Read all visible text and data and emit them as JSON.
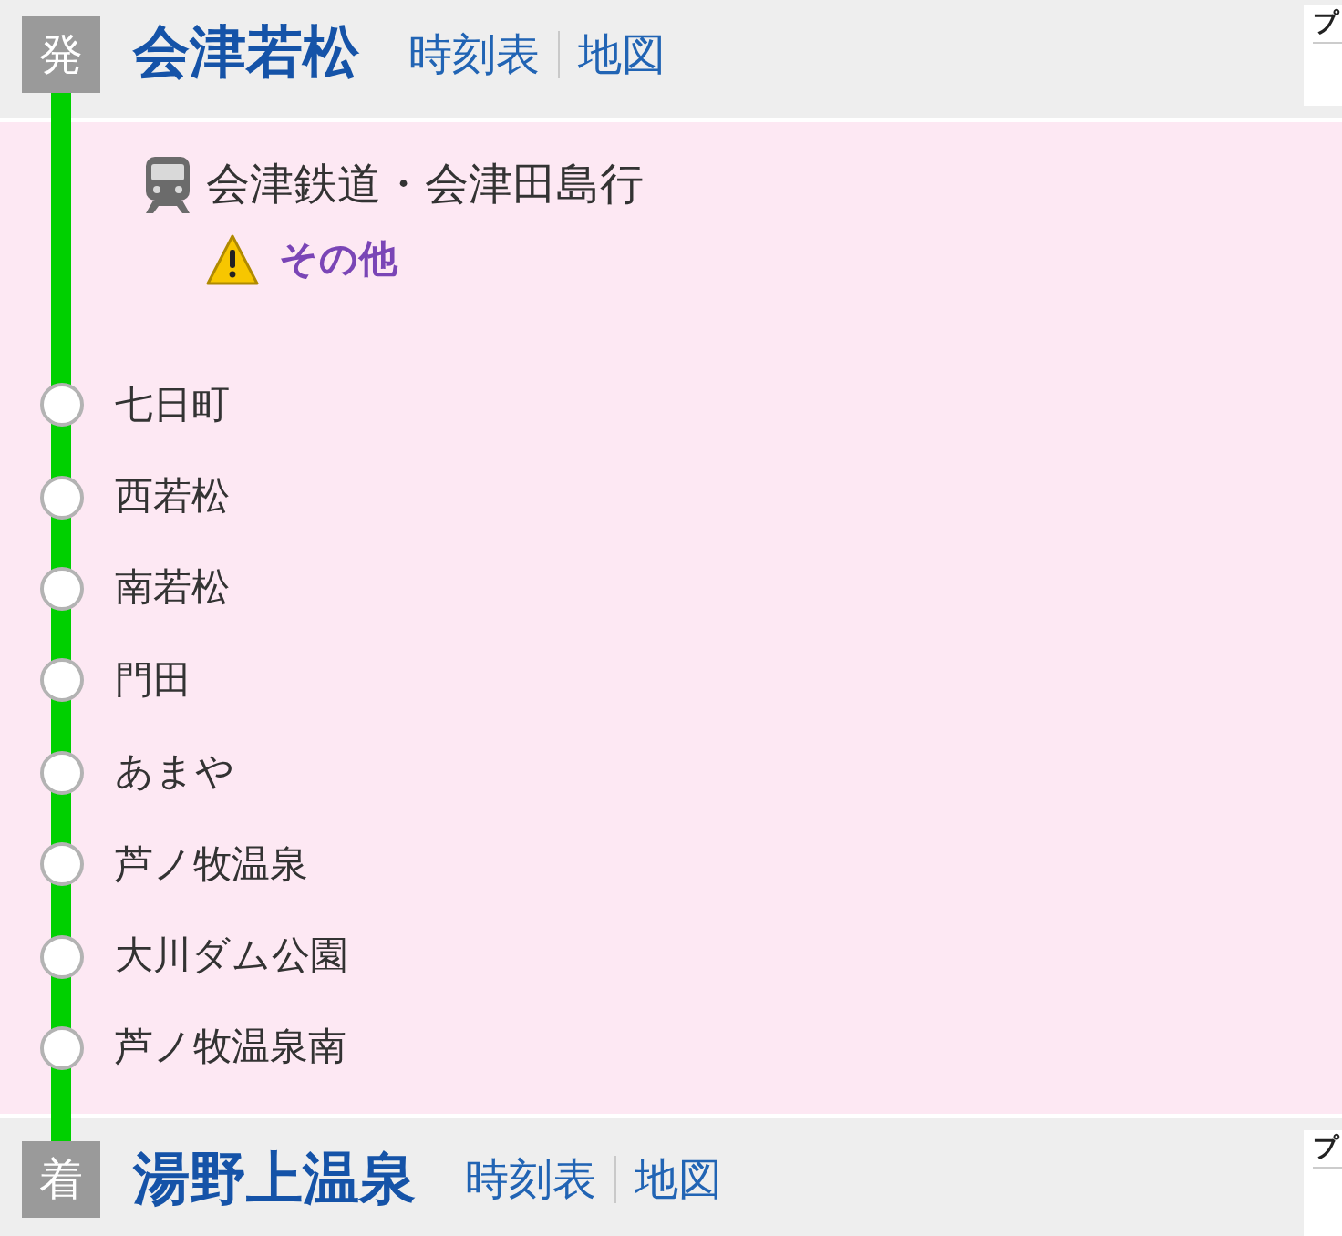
{
  "departure": {
    "badge": "発",
    "station": "会津若松",
    "links": [
      "時刻表",
      "地図"
    ],
    "side_card": {
      "title": "プ"
    }
  },
  "segment": {
    "line": "会津鉄道・会津田島行",
    "notice": "その他",
    "stops": [
      {
        "name": "七日町"
      },
      {
        "name": "西若松"
      },
      {
        "name": "南若松"
      },
      {
        "name": "門田"
      },
      {
        "name": "あまや"
      },
      {
        "name": "芦ノ牧温泉"
      },
      {
        "name": "大川ダム公園"
      },
      {
        "name": "芦ノ牧温泉南"
      }
    ]
  },
  "arrival": {
    "badge": "着",
    "station": "湯野上温泉",
    "links": [
      "時刻表",
      "地図"
    ],
    "side_card": {
      "title": "プ"
    }
  }
}
